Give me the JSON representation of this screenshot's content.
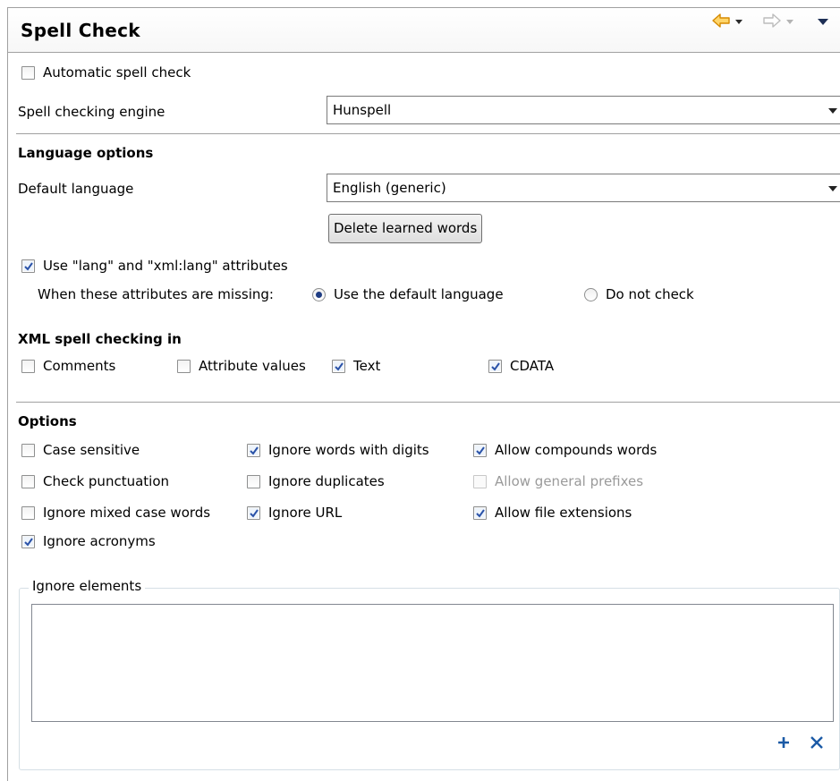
{
  "header": {
    "title": "Spell Check"
  },
  "general": {
    "automatic_spell_check": {
      "label": "Automatic spell check",
      "checked": false
    },
    "engine_label": "Spell checking engine",
    "engine_value": "Hunspell"
  },
  "language": {
    "section_title": "Language options",
    "default_language_label": "Default language",
    "default_language_value": "English (generic)",
    "delete_learned_words": "Delete learned words",
    "use_lang_attrs": {
      "label": "Use \"lang\" and \"xml:lang\" attributes",
      "checked": true
    },
    "missing_label": "When these attributes are missing:",
    "radio_default": {
      "label": "Use the default language",
      "selected": true
    },
    "radio_no_check": {
      "label": "Do not check",
      "selected": false
    }
  },
  "xml": {
    "section_title": "XML spell checking in",
    "comments": {
      "label": "Comments",
      "checked": false
    },
    "attribute_values": {
      "label": "Attribute values",
      "checked": false
    },
    "text": {
      "label": "Text",
      "checked": true
    },
    "cdata": {
      "label": "CDATA",
      "checked": true
    }
  },
  "options": {
    "section_title": "Options",
    "case_sensitive": {
      "label": "Case sensitive",
      "checked": false
    },
    "check_punctuation": {
      "label": "Check punctuation",
      "checked": false
    },
    "ignore_mixed_case": {
      "label": "Ignore mixed case words",
      "checked": false
    },
    "ignore_acronyms": {
      "label": "Ignore acronyms",
      "checked": true
    },
    "ignore_digits": {
      "label": "Ignore words with digits",
      "checked": true
    },
    "ignore_duplicates": {
      "label": "Ignore duplicates",
      "checked": false
    },
    "ignore_url": {
      "label": "Ignore URL",
      "checked": true
    },
    "allow_compounds": {
      "label": "Allow compounds words",
      "checked": true
    },
    "allow_prefixes": {
      "label": "Allow general prefixes",
      "checked": false,
      "enabled": false
    },
    "allow_extensions": {
      "label": "Allow file extensions",
      "checked": true
    }
  },
  "ignore_elements": {
    "group_label": "Ignore elements",
    "items": [],
    "add_icon": "plus-icon",
    "remove_icon": "close-icon"
  },
  "colors": {
    "nav_arrow_active": "#f0a820",
    "nav_arrow_inactive": "#c8c8c8",
    "check_mark": "#2a52a8",
    "action_icon": "#1b5aa6"
  }
}
